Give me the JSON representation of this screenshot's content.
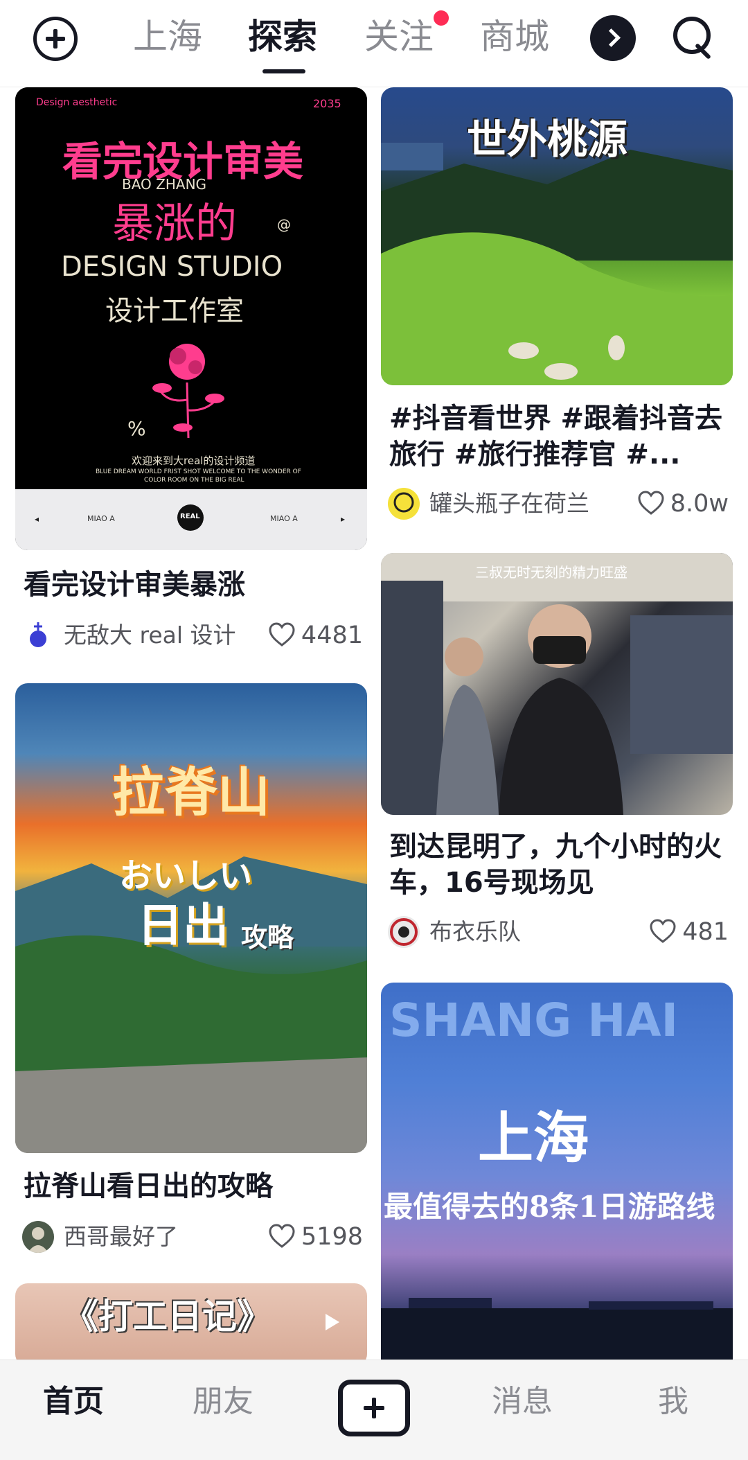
{
  "top_nav": {
    "tabs": [
      "上海",
      "探索",
      "关注",
      "商城"
    ],
    "active_tab": "探索",
    "notification_dot_color": "#fe2c55"
  },
  "feed": {
    "cards": [
      {
        "cover_text": {
          "brand": "Design aesthetic",
          "year": "2035",
          "headline": "看完设计审美",
          "pinyin": "BAO   ZHANG",
          "headline2": "暴涨的",
          "at": "@",
          "studio_en": "DESIGN STUDIO",
          "studio_cn": "设计工作室",
          "percent": "%",
          "welcome": "欢迎来到大real的设计频道",
          "tagline1": "BLUE DREAM WORLD FRIST SHOT   WELCOME TO THE WONDER OF",
          "tagline2": "COLOR ROOM ON THE BIG REAL",
          "strip_left": "MIAO A",
          "strip_right": "MIAO A",
          "badge": "REAL"
        },
        "title": "看完设计审美暴涨",
        "author": "无敌大 real 设计",
        "likes": "4481"
      },
      {
        "cover_text": {
          "overlay": "世外桃源"
        },
        "title": "#抖音看世界 #跟着抖音去旅行 #旅行推荐官 #...",
        "author": "罐头瓶子在荷兰",
        "likes": "8.0w"
      },
      {
        "cover_text": {
          "overlay": "三叔无时无刻的精力旺盛"
        },
        "title": "到达昆明了，九个小时的火车，16号现场见",
        "author": "布衣乐队",
        "likes": "481"
      },
      {
        "cover_text": {
          "line1": "拉脊山",
          "line2": "おいしい",
          "line3": "日出",
          "line4": "攻略"
        },
        "title": "拉脊山看日出的攻略",
        "author": "西哥最好了",
        "likes": "5198"
      },
      {
        "cover_text": {
          "en": "SHANG HAI",
          "cn1": "上海",
          "cn2": "最值得去的8条1日游路线"
        }
      },
      {
        "cover_text": {
          "overlay": "《打工日记》"
        }
      }
    ]
  },
  "bottom_nav": {
    "items": [
      "首页",
      "朋友",
      "消息",
      "我"
    ],
    "active_item": "首页"
  }
}
